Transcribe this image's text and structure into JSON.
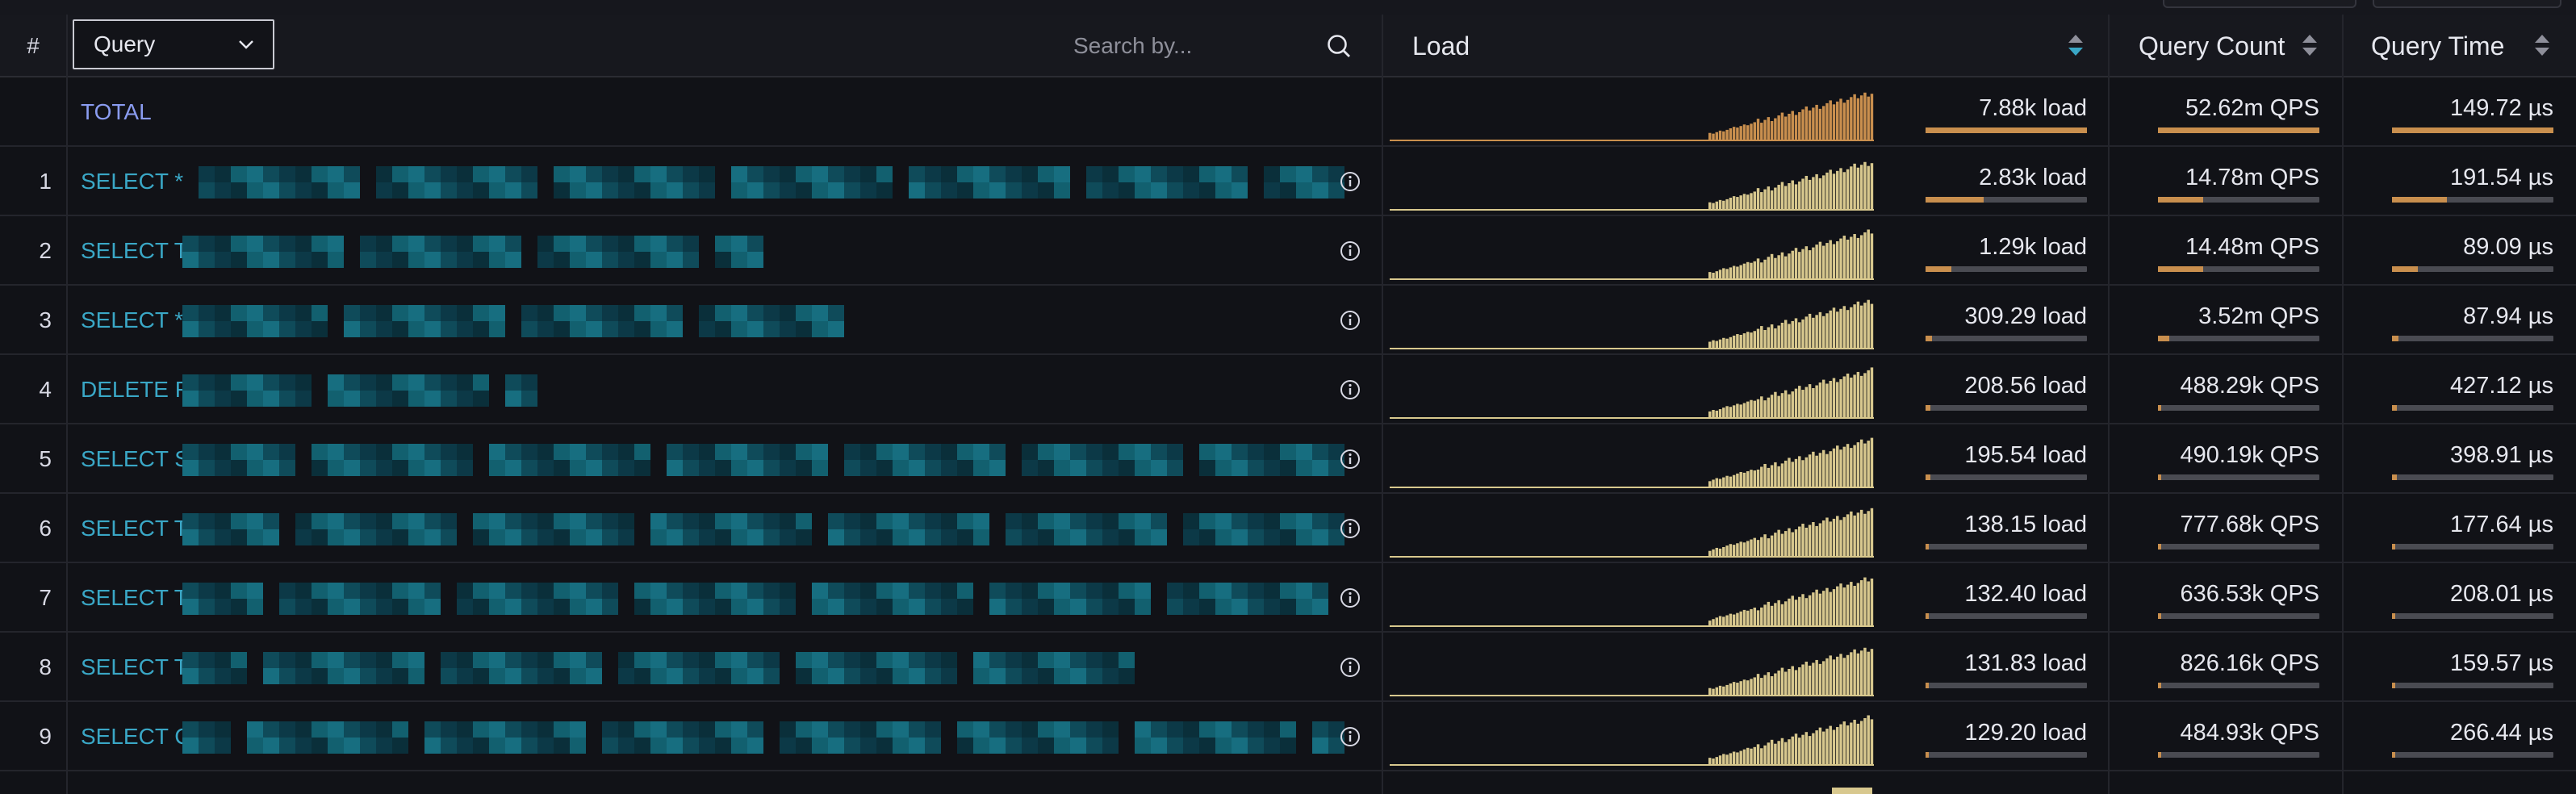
{
  "header": {
    "index_label": "#",
    "dropdown_value": "Query",
    "search_placeholder": "Search by...",
    "col_load": "Load",
    "col_count": "Query Count",
    "col_time": "Query Time"
  },
  "total_row": {
    "label": "TOTAL",
    "load": "7.88k load",
    "count": "52.62m QPS",
    "time": "149.72 µs",
    "load_fraction": 1.0,
    "count_fraction": 1.0,
    "time_fraction": 1.0
  },
  "rows": [
    {
      "index": "1",
      "query": "SELECT *",
      "load": "2.83k load",
      "count": "14.78m QPS",
      "time": "191.54 µs",
      "load_fraction": 0.36,
      "count_fraction": 0.28,
      "time_fraction": 0.34
    },
    {
      "index": "2",
      "query": "SELECT T",
      "load": "1.29k load",
      "count": "14.48m QPS",
      "time": "89.09 µs",
      "load_fraction": 0.16,
      "count_fraction": 0.28,
      "time_fraction": 0.16
    },
    {
      "index": "3",
      "query": "SELECT *",
      "load": "309.29 load",
      "count": "3.52m QPS",
      "time": "87.94 µs",
      "load_fraction": 0.04,
      "count_fraction": 0.07,
      "time_fraction": 0.04
    },
    {
      "index": "4",
      "query": "DELETE F",
      "load": "208.56 load",
      "count": "488.29k QPS",
      "time": "427.12 µs",
      "load_fraction": 0.03,
      "count_fraction": 0.02,
      "time_fraction": 0.03
    },
    {
      "index": "5",
      "query": "SELECT S",
      "load": "195.54 load",
      "count": "490.19k QPS",
      "time": "398.91 µs",
      "load_fraction": 0.03,
      "count_fraction": 0.02,
      "time_fraction": 0.03
    },
    {
      "index": "6",
      "query": "SELECT T",
      "load": "138.15 load",
      "count": "777.68k QPS",
      "time": "177.64 µs",
      "load_fraction": 0.02,
      "count_fraction": 0.02,
      "time_fraction": 0.02
    },
    {
      "index": "7",
      "query": "SELECT T",
      "load": "132.40 load",
      "count": "636.53k QPS",
      "time": "208.01 µs",
      "load_fraction": 0.02,
      "count_fraction": 0.02,
      "time_fraction": 0.02
    },
    {
      "index": "8",
      "query": "SELECT T",
      "load": "131.83 load",
      "count": "826.16k QPS",
      "time": "159.57 µs",
      "load_fraction": 0.02,
      "count_fraction": 0.02,
      "time_fraction": 0.02
    },
    {
      "index": "9",
      "query": "SELECT C",
      "load": "129.20 load",
      "count": "484.93k QPS",
      "time": "266.44 µs",
      "load_fraction": 0.02,
      "count_fraction": 0.02,
      "time_fraction": 0.02
    }
  ],
  "colors": {
    "accent_total": "#c98f4e",
    "sparkline_rows": "#d8c88e",
    "sort_active": "#3aa7c6",
    "query_text": "#3aa7c6",
    "total_text": "#8a9cf0"
  },
  "icons": [
    "chevron-down-icon",
    "search-icon",
    "sort-icon",
    "info-icon"
  ]
}
